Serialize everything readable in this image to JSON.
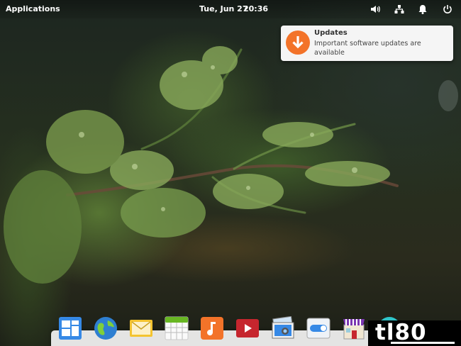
{
  "panel": {
    "applications_label": "Applications",
    "date": "Tue, Jun 27",
    "time": "20:36",
    "tray_icons": [
      "volume-icon",
      "network-icon",
      "notifications-bell-icon",
      "power-icon"
    ]
  },
  "notification": {
    "title": "Updates",
    "body": "Important software updates are available",
    "icon": "download-arrow-icon",
    "accent_color": "#f37329"
  },
  "dock": {
    "apps": [
      {
        "name": "multitasking-view",
        "icon": "windows-grid-icon"
      },
      {
        "name": "web-browser",
        "icon": "globe-icon"
      },
      {
        "name": "mail",
        "icon": "envelope-icon"
      },
      {
        "name": "calendar",
        "icon": "calendar-icon"
      },
      {
        "name": "music",
        "icon": "music-note-icon"
      },
      {
        "name": "videos",
        "icon": "play-icon"
      },
      {
        "name": "photos",
        "icon": "photos-icon"
      },
      {
        "name": "system-settings",
        "icon": "toggle-switch-icon"
      },
      {
        "name": "appcenter",
        "icon": "store-icon"
      },
      {
        "name": "wifi-app",
        "icon": "wifi-icon"
      }
    ]
  },
  "watermark": {
    "text": "tl80"
  }
}
